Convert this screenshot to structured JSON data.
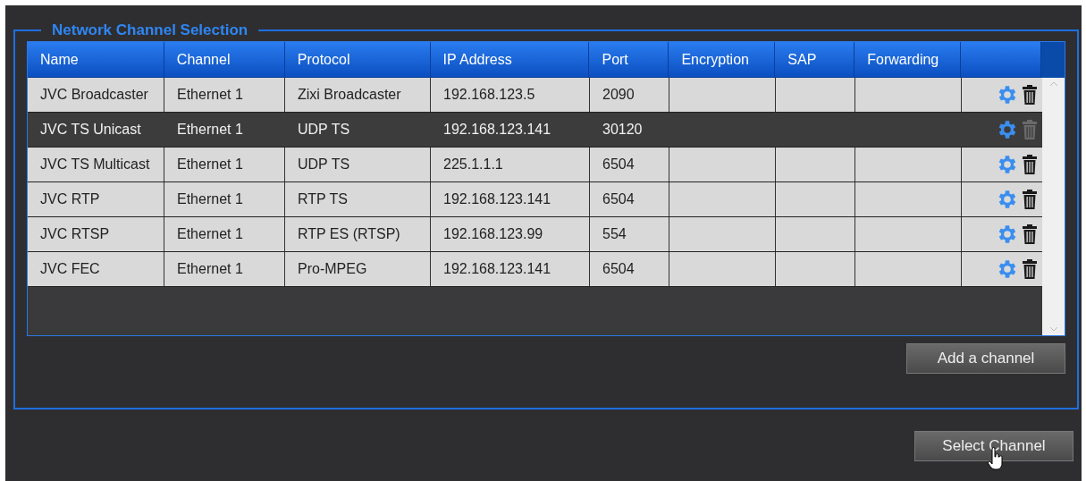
{
  "panel": {
    "title": "Network Channel Selection"
  },
  "table": {
    "columns": [
      "Name",
      "Channel",
      "Protocol",
      "IP Address",
      "Port",
      "Encryption",
      "SAP",
      "Forwarding"
    ],
    "rows": [
      {
        "cells": [
          "JVC Broadcaster",
          "Ethernet 1",
          "Zixi Broadcaster",
          "192.168.123.5",
          "2090",
          "",
          "",
          ""
        ],
        "selected": false
      },
      {
        "cells": [
          "JVC TS Unicast",
          "Ethernet 1",
          "UDP TS",
          "192.168.123.141",
          "30120",
          "",
          "",
          ""
        ],
        "selected": true
      },
      {
        "cells": [
          "JVC TS Multicast",
          "Ethernet 1",
          "UDP TS",
          "225.1.1.1",
          "6504",
          "",
          "",
          ""
        ],
        "selected": false
      },
      {
        "cells": [
          "JVC RTP",
          "Ethernet 1",
          "RTP TS",
          "192.168.123.141",
          "6504",
          "",
          "",
          ""
        ],
        "selected": false
      },
      {
        "cells": [
          "JVC RTSP",
          "Ethernet 1",
          "RTP ES (RTSP)",
          "192.168.123.99",
          "554",
          "",
          "",
          ""
        ],
        "selected": false
      },
      {
        "cells": [
          "JVC FEC",
          "Ethernet 1",
          "Pro-MPEG",
          "192.168.123.141",
          "6504",
          "",
          "",
          ""
        ],
        "selected": false
      }
    ]
  },
  "add_button": "Add a channel",
  "select_button": "Select Channel"
}
